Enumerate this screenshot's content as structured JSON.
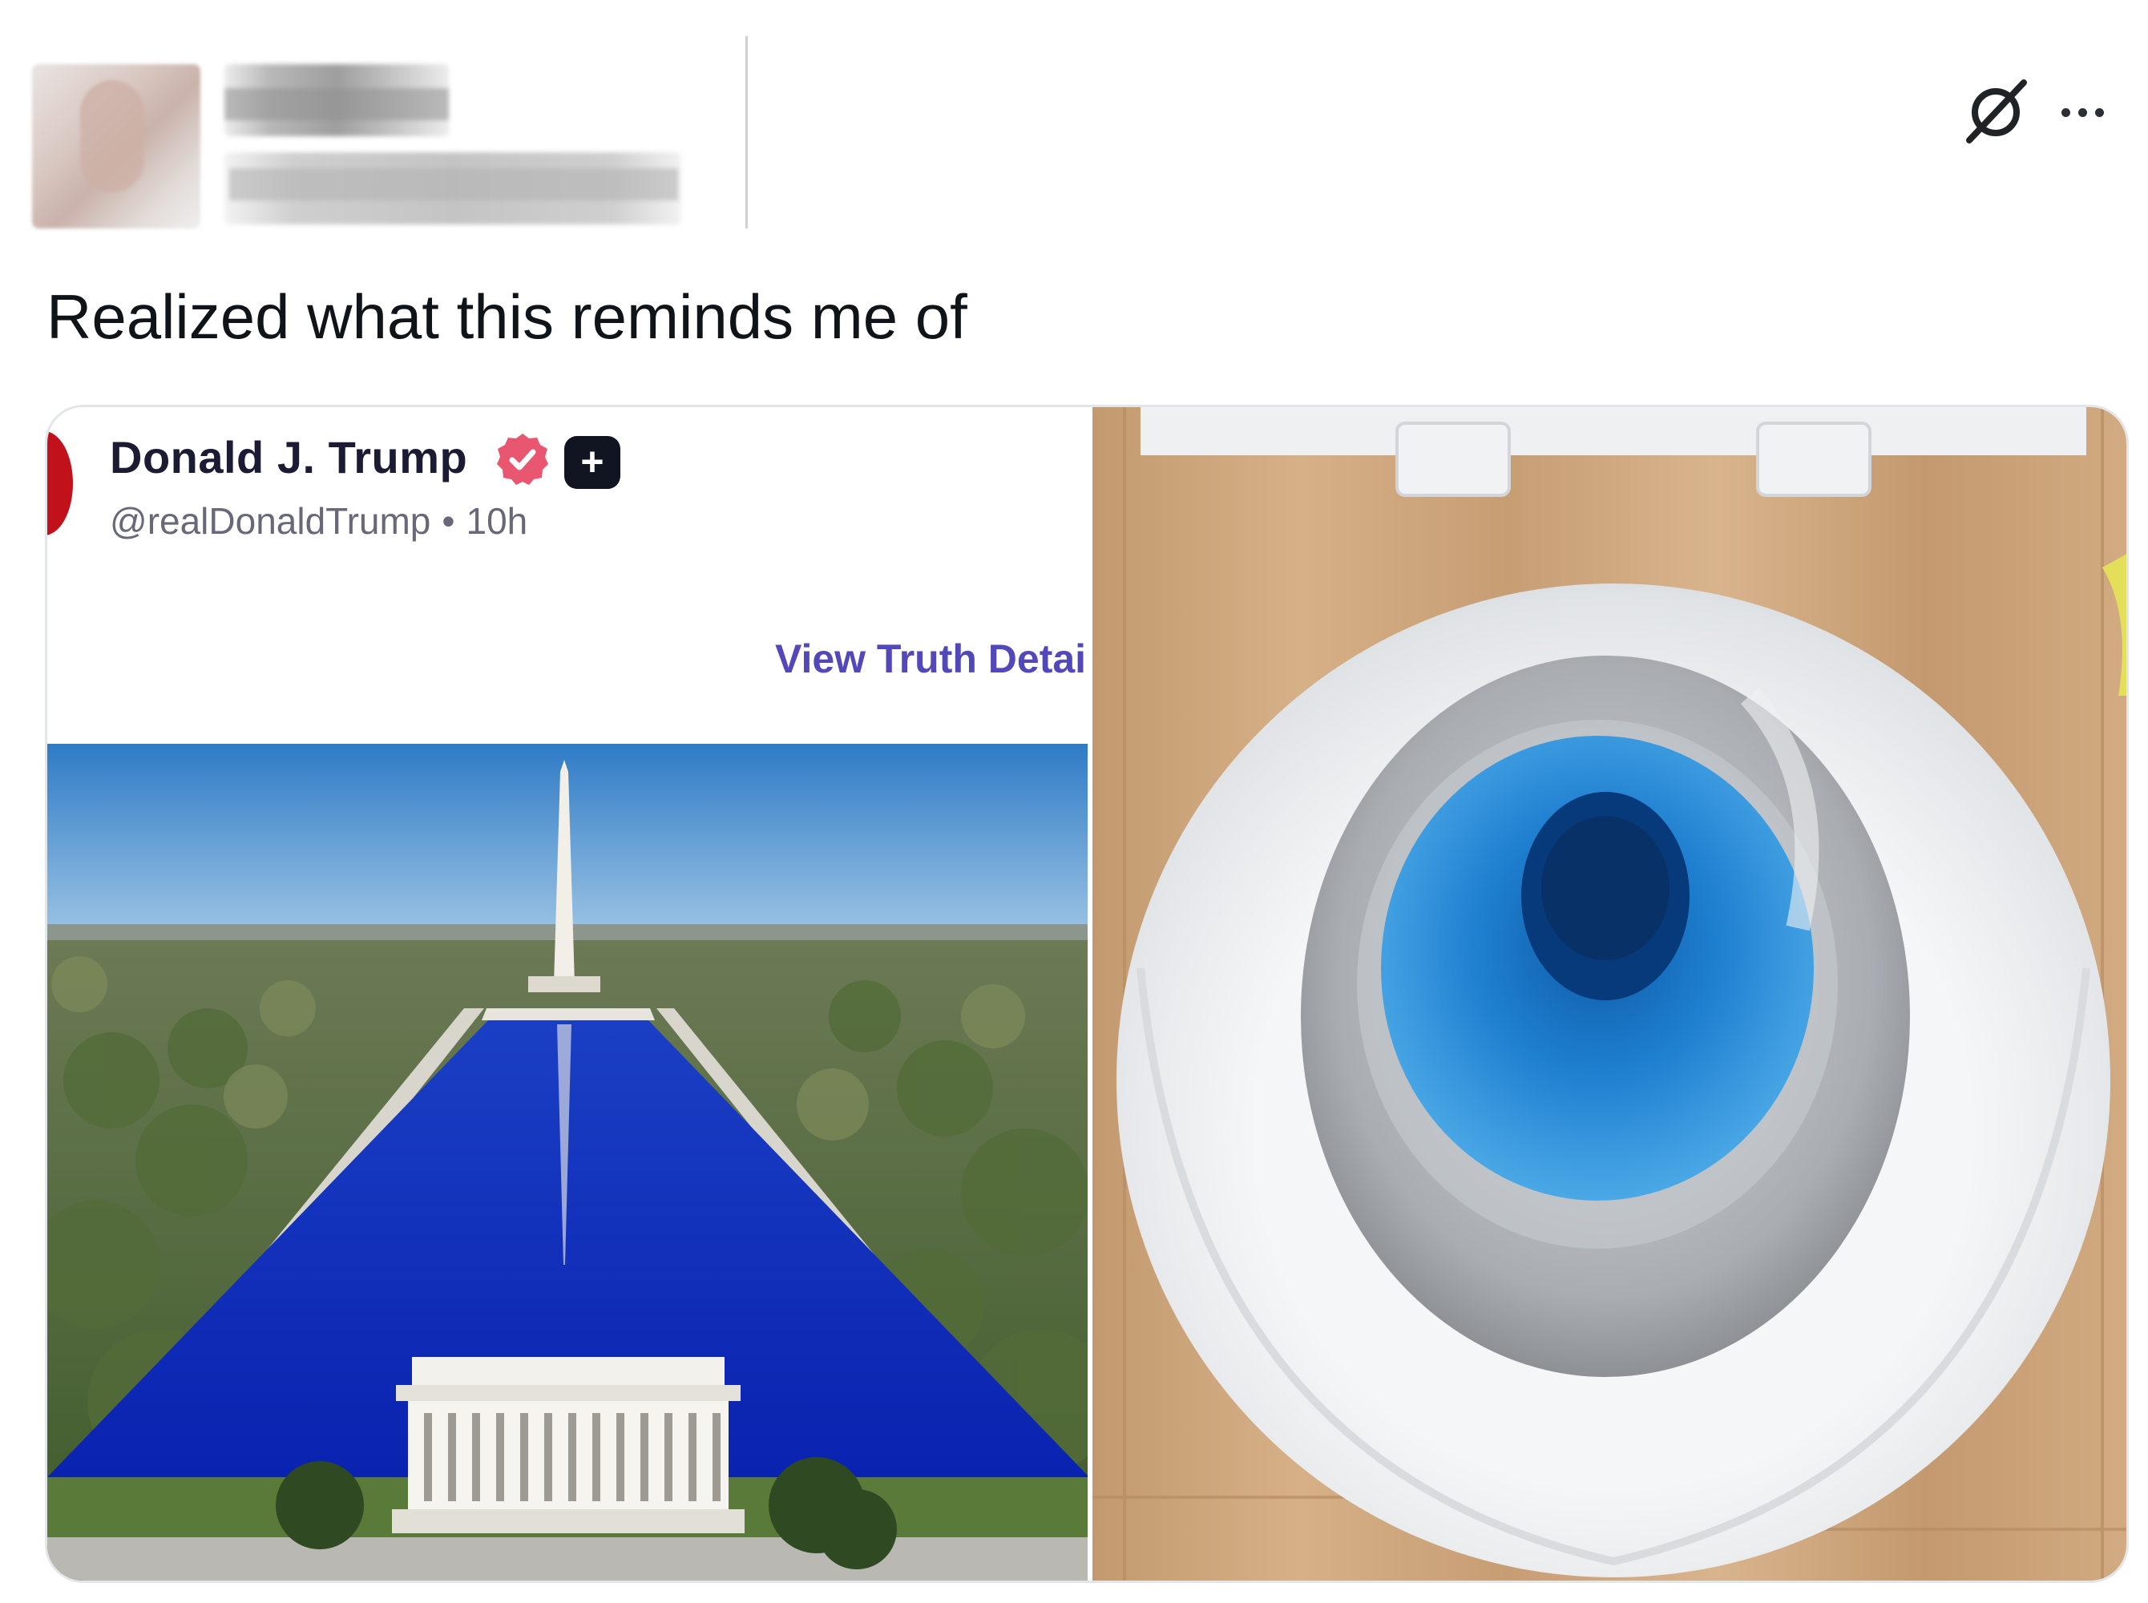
{
  "post": {
    "text": "Realized what this reminds me of"
  },
  "header_icons": {
    "grok": "grok-icon",
    "more": "more-options-icon"
  },
  "embedded_post": {
    "author_name": "Donald J. Trump",
    "handle": "@realDonaldTrump",
    "separator": "•",
    "time": "10h",
    "verified_badge": "verified-badge-icon",
    "plus_badge": "+",
    "link_text": "View Truth Detai",
    "link_color": "#5248b9"
  },
  "colors": {
    "text": "#0f1419",
    "reflecting_pool": "#0a2fbf",
    "toilet_water": "#1f7fd0",
    "verified": "#e8566f"
  }
}
